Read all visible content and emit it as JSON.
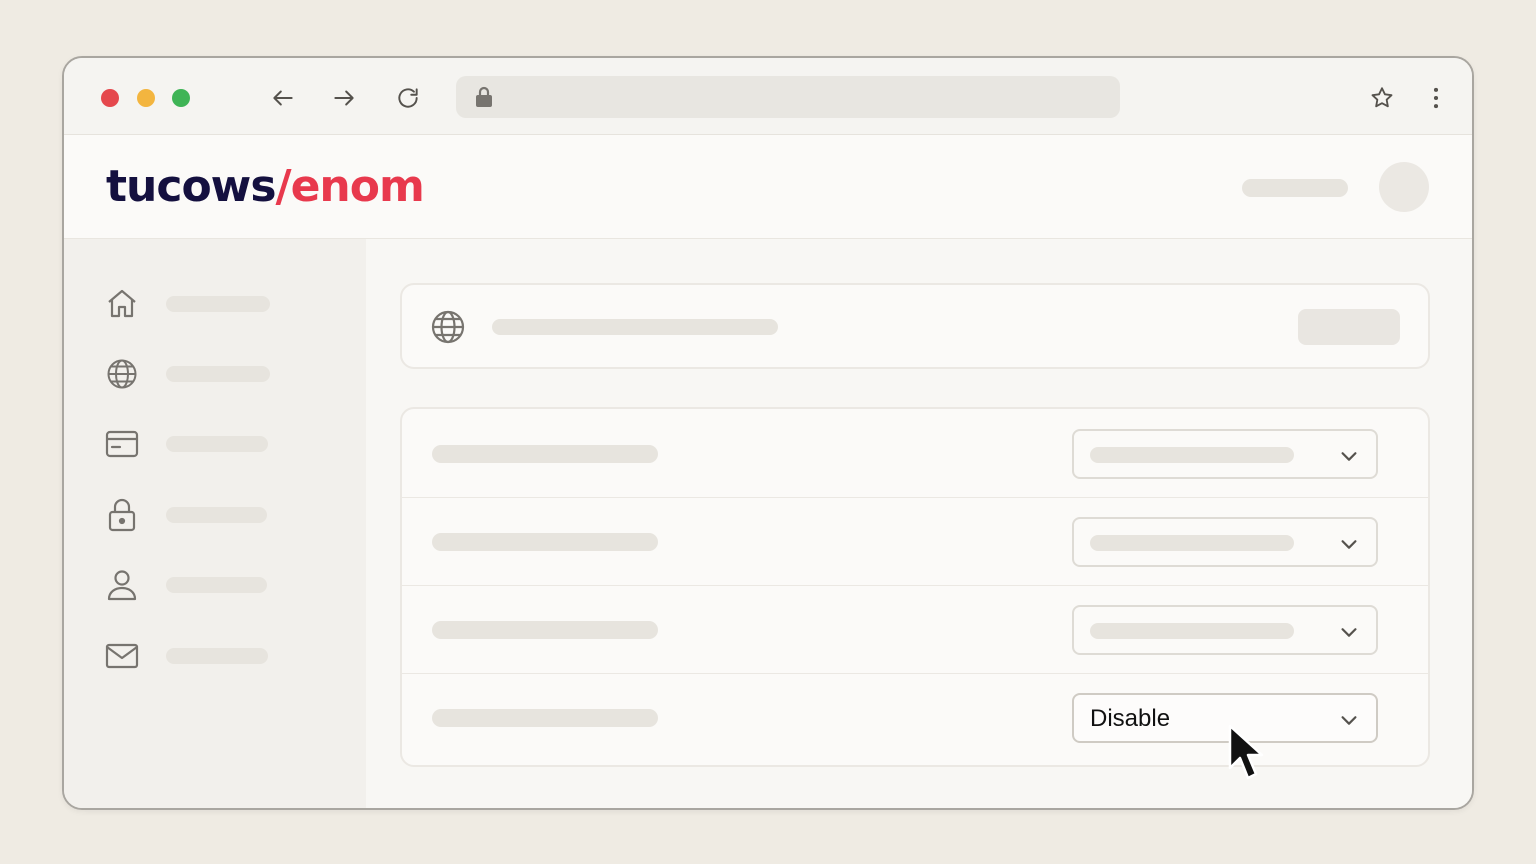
{
  "browser": {
    "url_value": "",
    "window_controls": [
      "close",
      "minimize",
      "maximize"
    ],
    "nav_icons": [
      "back-arrow-icon",
      "forward-arrow-icon",
      "reload-icon"
    ],
    "toolbar_icons": [
      "star-icon",
      "more-vertical-icon"
    ]
  },
  "header": {
    "logo_part1": "tucows",
    "logo_part2": "/enom",
    "brand_colors": {
      "dark": "#14103f",
      "accent": "#e8394d"
    }
  },
  "sidebar": {
    "items": [
      {
        "icon": "home-icon",
        "label": ""
      },
      {
        "icon": "globe-icon",
        "label": ""
      },
      {
        "icon": "credit-card-icon",
        "label": ""
      },
      {
        "icon": "lock-icon",
        "label": ""
      },
      {
        "icon": "user-icon",
        "label": ""
      },
      {
        "icon": "mail-icon",
        "label": ""
      }
    ]
  },
  "main": {
    "domain_card": {
      "icon": "globe-icon",
      "title": "",
      "button_label": ""
    },
    "settings": [
      {
        "label": "",
        "value": ""
      },
      {
        "label": "",
        "value": ""
      },
      {
        "label": "",
        "value": ""
      },
      {
        "label": "",
        "value": "Disable"
      }
    ]
  }
}
